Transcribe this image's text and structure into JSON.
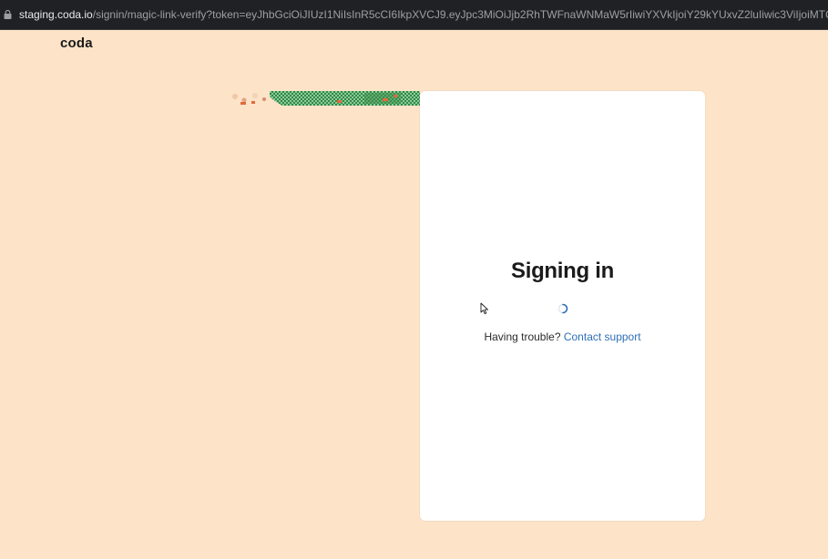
{
  "browser": {
    "url_host": "staging.coda.io",
    "url_rest": "/signin/magic-link-verify?token=eyJhbGciOiJIUzI1NiIsInR5cCI6IkpXVCJ9.eyJpc3MiOiJjb2RhTWFnaWNMaW5rIiwiYXVkIjoiY29kYUxvZ2luIiwic3ViIjoiMTQ0NjE4IiwianRpIjoiN",
    "lock_icon": "lock-icon"
  },
  "header": {
    "logo_text": "coda"
  },
  "card": {
    "title": "Signing in",
    "trouble_text": "Having trouble?",
    "support_link": "Contact support",
    "spinner_icon": "spinner-icon"
  },
  "colors": {
    "page_bg": "#fde3c8",
    "card_bg": "#ffffff",
    "link": "#2e6fb5",
    "urlbar_bg": "#202124"
  }
}
